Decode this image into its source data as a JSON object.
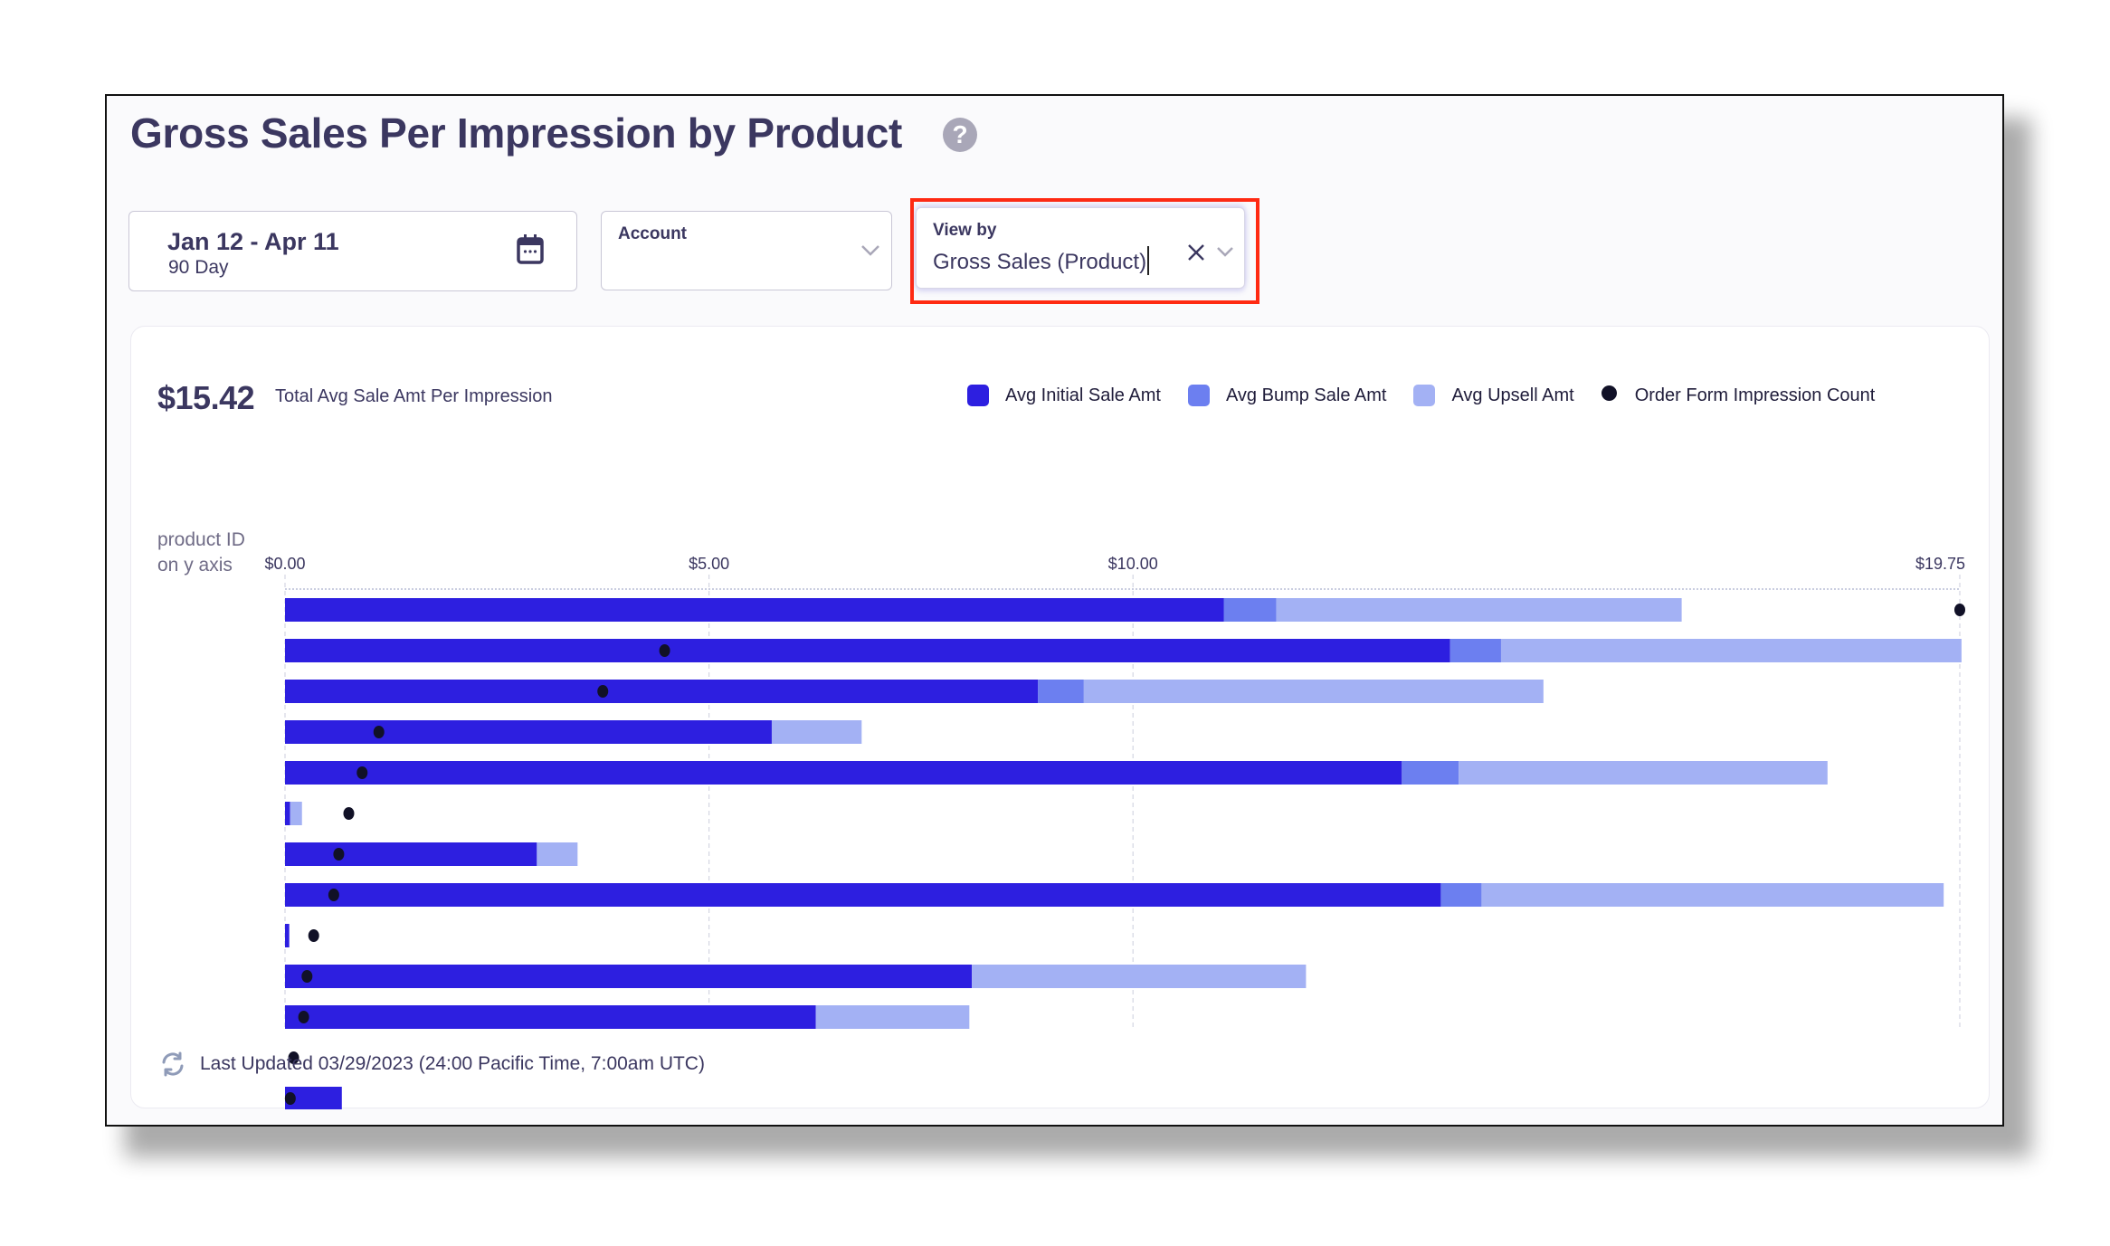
{
  "header": {
    "title": "Gross Sales Per Impression by Product",
    "help_icon": "question-circle-icon",
    "help_glyph": "?"
  },
  "filters": {
    "date_range": {
      "label": "Jan 12 - Apr 11",
      "sublabel": "90 Day",
      "icon": "calendar-icon"
    },
    "account": {
      "label": "Account",
      "value": "",
      "icon": "chevron-down-icon"
    },
    "view_by": {
      "label": "View by",
      "value": "Gross Sales (Product)",
      "clear_icon": "close-icon",
      "icon": "chevron-down-icon",
      "highlighted": true
    }
  },
  "summary": {
    "value": "$15.42",
    "label": "Total Avg Sale Amt Per Impression"
  },
  "colors": {
    "initial": "#2d1fe0",
    "bump": "#6c7ff0",
    "upsell": "#a3b1f4",
    "dot": "#111127",
    "highlight": "#ff2a12"
  },
  "chart_data": {
    "type": "bar",
    "orientation": "horizontal",
    "stacked": true,
    "title": "Gross Sales Per Impression by Product",
    "xlabel": "",
    "ylabel": "product ID\non y axis",
    "xlim": [
      0,
      19.75
    ],
    "x_ticks": [
      {
        "value": 0,
        "label": "$0.00"
      },
      {
        "value": 5,
        "label": "$5.00"
      },
      {
        "value": 10,
        "label": "$10.00"
      },
      {
        "value": 19.75,
        "label": "$19.75"
      }
    ],
    "grid": true,
    "legend_position": "top-right",
    "legend": [
      {
        "name": "Avg Initial Sale Amt",
        "kind": "swatch",
        "color_key": "initial"
      },
      {
        "name": "Avg Bump Sale Amt",
        "kind": "swatch",
        "color_key": "bump"
      },
      {
        "name": "Avg Upsell Amt",
        "kind": "swatch",
        "color_key": "upsell"
      },
      {
        "name": "Order Form Impression Count",
        "kind": "dot",
        "color_key": "dot"
      }
    ],
    "categories": [
      "",
      "",
      "",
      "",
      "",
      "",
      "",
      "",
      "",
      "",
      "",
      "",
      ""
    ],
    "series": [
      {
        "name": "Avg Initial Sale Amt",
        "color_key": "initial",
        "values": [
          11.07,
          13.74,
          8.88,
          5.74,
          13.17,
          0.06,
          2.97,
          13.63,
          0.05,
          8.1,
          6.26,
          0,
          0.67
        ]
      },
      {
        "name": "Avg Bump Sale Amt",
        "color_key": "bump",
        "values": [
          0.62,
          0.6,
          0.54,
          0,
          0.67,
          0,
          0,
          0.48,
          0,
          0,
          0,
          0,
          0
        ]
      },
      {
        "name": "Avg Upsell Amt",
        "color_key": "upsell",
        "values": [
          4.78,
          5.43,
          5.42,
          1.06,
          4.35,
          0.14,
          0.48,
          5.45,
          0,
          3.94,
          1.81,
          0,
          0
        ]
      }
    ],
    "dot_series": {
      "name": "Order Form Impression Count",
      "scale_note": "relative to largest count (separate, unlabeled scale)",
      "values": [
        1.0,
        0.225,
        0.188,
        0.054,
        0.044,
        0.036,
        0.03,
        0.027,
        0.015,
        0.011,
        0.009,
        0.003,
        0.001
      ]
    }
  },
  "footer": {
    "icon": "refresh-icon",
    "text": "Last Updated 03/29/2023 (24:00 Pacific Time, 7:00am UTC)"
  }
}
